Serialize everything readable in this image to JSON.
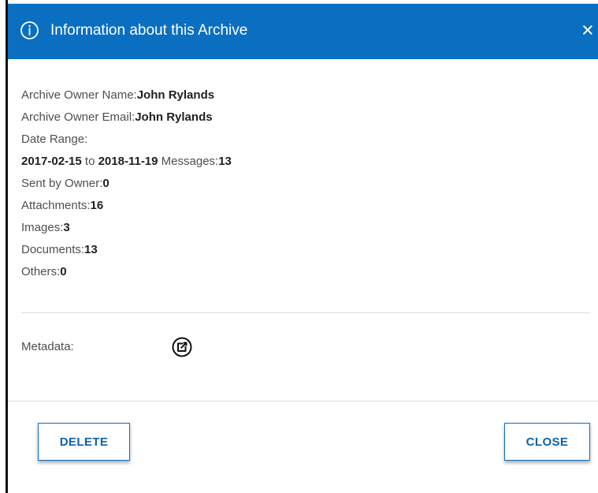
{
  "dialog": {
    "title": "Information about this Archive",
    "close_icon_text": "×",
    "info_icon": "info-circle-icon",
    "close_icon": "close-icon",
    "colors": {
      "header_background": "#0b6fc1",
      "header_text": "#ffffff",
      "button_text": "#0b63ad",
      "body_text": "#4f4f4f",
      "value_text": "#1f1f1f"
    }
  },
  "details": {
    "owner_name_label": "Archive Owner Name:",
    "owner_name_value": "John Rylands",
    "owner_email_label": "Archive Owner Email:",
    "owner_email_value": "John Rylands",
    "date_range_label": "Date Range:",
    "date_from": "2017-02-15",
    "date_to_word": " to ",
    "date_to": "2018-11-19",
    "messages_label": " Messages:",
    "messages_value": "13",
    "sent_by_owner_label": "Sent by Owner:",
    "sent_by_owner_value": "0",
    "attachments_label": "Attachments:",
    "attachments_value": "16",
    "images_label": "Images:",
    "images_value": "3",
    "documents_label": "Documents:",
    "documents_value": "13",
    "others_label": "Others:",
    "others_value": "0"
  },
  "metadata": {
    "label": "Metadata:",
    "icon": "edit-external-icon"
  },
  "actions": {
    "delete_label": "DELETE",
    "close_label": "CLOSE"
  }
}
